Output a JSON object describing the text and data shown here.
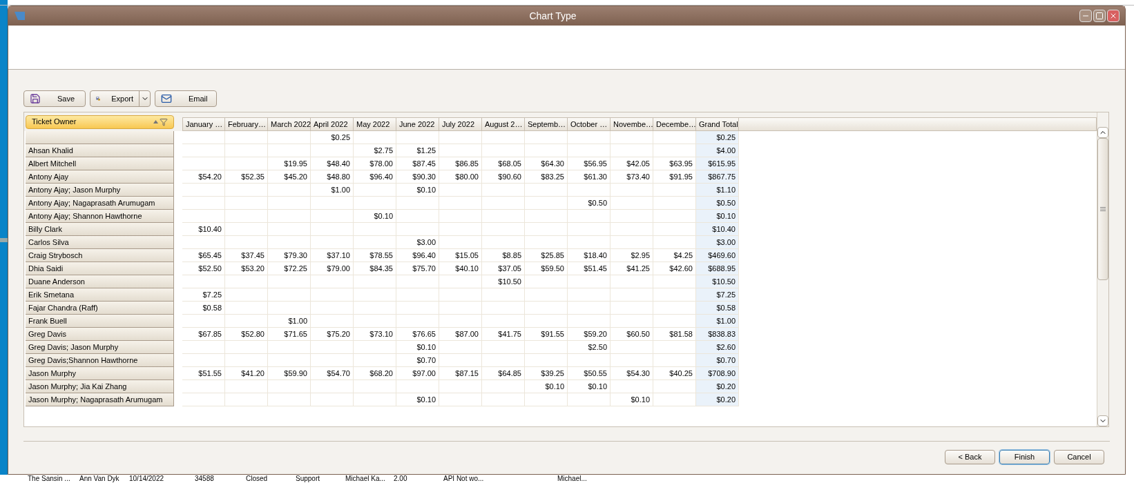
{
  "window": {
    "title": "Chart Type"
  },
  "toolbar": [
    {
      "label": "Save",
      "kind": "save"
    },
    {
      "label": "Export",
      "kind": "export"
    },
    {
      "label": "Email",
      "kind": "email"
    }
  ],
  "pivot": {
    "row_field": "Ticket Owner",
    "columns": [
      "January …",
      "February…",
      "March 2022",
      "April 2022",
      "May 2022",
      "June 2022",
      "July 2022",
      "August 2…",
      "Septemb…",
      "October …",
      "Novembe…",
      "Decembe…",
      "Grand Total"
    ],
    "rows": [
      {
        "cells": [
          null,
          null,
          null,
          "$0.25",
          null,
          null,
          null,
          null,
          null,
          null,
          null,
          null,
          "$0.25"
        ]
      },
      {
        "owner": "Ahsan Khalid",
        "cells": [
          null,
          null,
          null,
          null,
          "$2.75",
          "$1.25",
          null,
          null,
          null,
          null,
          null,
          null,
          "$4.00"
        ]
      },
      {
        "owner": "Albert Mitchell",
        "cells": [
          null,
          null,
          "$19.95",
          "$48.40",
          "$78.00",
          "$87.45",
          "$86.85",
          "$68.05",
          "$64.30",
          "$56.95",
          "$42.05",
          "$63.95",
          "$615.95"
        ]
      },
      {
        "owner": "Antony Ajay",
        "cells": [
          "$54.20",
          "$52.35",
          "$45.20",
          "$48.80",
          "$96.40",
          "$90.30",
          "$80.00",
          "$90.60",
          "$83.25",
          "$61.30",
          "$73.40",
          "$91.95",
          "$867.75"
        ]
      },
      {
        "owner": "Antony Ajay; Jason Murphy",
        "cells": [
          null,
          null,
          null,
          "$1.00",
          null,
          "$0.10",
          null,
          null,
          null,
          null,
          null,
          null,
          "$1.10"
        ]
      },
      {
        "owner": "Antony Ajay; Nagaprasath Arumugam",
        "cells": [
          null,
          null,
          null,
          null,
          null,
          null,
          null,
          null,
          null,
          "$0.50",
          null,
          null,
          "$0.50"
        ]
      },
      {
        "owner": "Antony Ajay; Shannon Hawthorne",
        "cells": [
          null,
          null,
          null,
          null,
          "$0.10",
          null,
          null,
          null,
          null,
          null,
          null,
          null,
          "$0.10"
        ]
      },
      {
        "owner": "Billy Clark",
        "cells": [
          "$10.40",
          null,
          null,
          null,
          null,
          null,
          null,
          null,
          null,
          null,
          null,
          null,
          "$10.40"
        ]
      },
      {
        "owner": "Carlos Silva",
        "cells": [
          null,
          null,
          null,
          null,
          null,
          "$3.00",
          null,
          null,
          null,
          null,
          null,
          null,
          "$3.00"
        ]
      },
      {
        "owner": "Craig Strybosch",
        "cells": [
          "$65.45",
          "$37.45",
          "$79.30",
          "$37.10",
          "$78.55",
          "$96.40",
          "$15.05",
          "$8.85",
          "$25.85",
          "$18.40",
          "$2.95",
          "$4.25",
          "$469.60"
        ]
      },
      {
        "owner": "Dhia Saidi",
        "cells": [
          "$52.50",
          "$53.20",
          "$72.25",
          "$79.00",
          "$84.35",
          "$75.70",
          "$40.10",
          "$37.05",
          "$59.50",
          "$51.45",
          "$41.25",
          "$42.60",
          "$688.95"
        ]
      },
      {
        "owner": "Duane Anderson",
        "cells": [
          null,
          null,
          null,
          null,
          null,
          null,
          null,
          "$10.50",
          null,
          null,
          null,
          null,
          "$10.50"
        ]
      },
      {
        "owner": "Erik Smetana",
        "cells": [
          "$7.25",
          null,
          null,
          null,
          null,
          null,
          null,
          null,
          null,
          null,
          null,
          null,
          "$7.25"
        ]
      },
      {
        "owner": "Fajar Chandra (Raff)",
        "cells": [
          "$0.58",
          null,
          null,
          null,
          null,
          null,
          null,
          null,
          null,
          null,
          null,
          null,
          "$0.58"
        ]
      },
      {
        "owner": "Frank Buell",
        "cells": [
          null,
          null,
          "$1.00",
          null,
          null,
          null,
          null,
          null,
          null,
          null,
          null,
          null,
          "$1.00"
        ]
      },
      {
        "owner": "Greg Davis",
        "cells": [
          "$67.85",
          "$52.80",
          "$71.65",
          "$75.20",
          "$73.10",
          "$76.65",
          "$87.00",
          "$41.75",
          "$91.55",
          "$59.20",
          "$60.50",
          "$81.58",
          "$838.83"
        ]
      },
      {
        "owner": "Greg Davis; Jason Murphy",
        "cells": [
          null,
          null,
          null,
          null,
          null,
          "$0.10",
          null,
          null,
          null,
          "$2.50",
          null,
          null,
          "$2.60"
        ]
      },
      {
        "owner": "Greg Davis;Shannon Hawthorne",
        "cells": [
          null,
          null,
          null,
          null,
          null,
          "$0.70",
          null,
          null,
          null,
          null,
          null,
          null,
          "$0.70"
        ]
      },
      {
        "owner": "Jason Murphy",
        "cells": [
          "$51.55",
          "$41.20",
          "$59.90",
          "$54.70",
          "$68.20",
          "$97.00",
          "$87.15",
          "$64.85",
          "$39.25",
          "$50.55",
          "$54.30",
          "$40.25",
          "$708.90"
        ]
      },
      {
        "owner": "Jason Murphy; Jia Kai Zhang",
        "cells": [
          null,
          null,
          null,
          null,
          null,
          null,
          null,
          null,
          "$0.10",
          "$0.10",
          null,
          null,
          "$0.20"
        ]
      },
      {
        "owner": "Jason Murphy; Nagaprasath Arumugam",
        "cells": [
          null,
          null,
          null,
          null,
          null,
          "$0.10",
          null,
          null,
          null,
          null,
          "$0.10",
          null,
          "$0.20"
        ]
      }
    ]
  },
  "footer_buttons": [
    {
      "label": "< Back",
      "focused": false
    },
    {
      "label": "Finish",
      "focused": true
    },
    {
      "label": "Cancel",
      "focused": false
    }
  ],
  "background_row": [
    "The Sansin ...",
    "Ann Van Dyk",
    "10/14/2022",
    "34588",
    "Closed",
    "Support",
    "Michael Ka...",
    "2.00",
    "API Not wo...",
    "Michael..."
  ]
}
